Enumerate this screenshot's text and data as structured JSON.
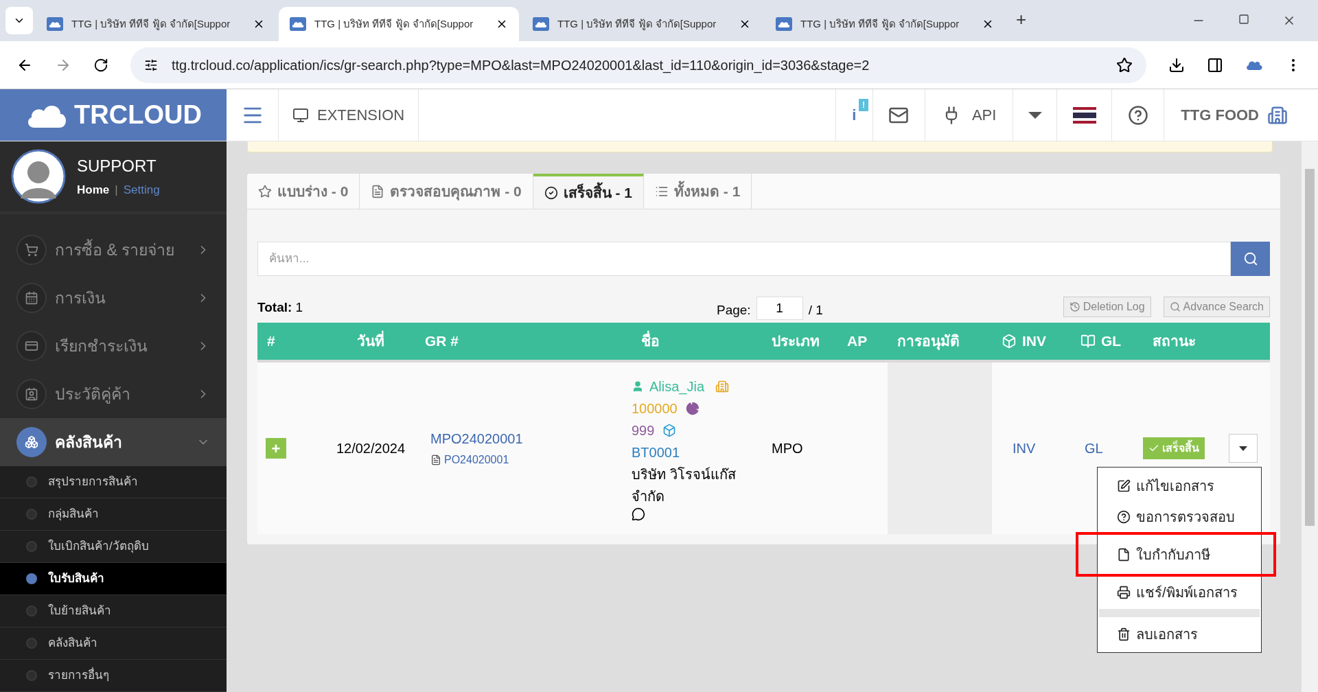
{
  "browser": {
    "tabs": [
      {
        "title": "TTG | บริษัท ทีทีจี ฟู้ด จำกัด[Suppor",
        "selected": false
      },
      {
        "title": "TTG | บริษัท ทีทีจี ฟู้ด จำกัด[Suppor",
        "selected": true
      },
      {
        "title": "TTG | บริษัท ทีทีจี ฟู้ด จำกัด[Suppor",
        "selected": false
      },
      {
        "title": "TTG | บริษัท ทีทีจี ฟู้ด จำกัด[Suppor",
        "selected": false
      }
    ],
    "new_tab": "+",
    "url": "ttg.trcloud.co/application/ics/gr-search.php?type=MPO&last=MPO24020001&last_id=110&origin_id=3036&stage=2"
  },
  "header": {
    "logo": "TRCLOUD",
    "extension": "EXTENSION",
    "info_icon": "i",
    "info_badge": "!",
    "api": "API",
    "company": "TTG FOOD"
  },
  "profile": {
    "name": "SUPPORT",
    "home": "Home",
    "separator": "|",
    "setting": "Setting"
  },
  "sidebar": {
    "items": [
      {
        "label": "การซื้อ & รายจ่าย",
        "kind": "cart",
        "selected": false
      },
      {
        "label": "การเงิน",
        "kind": "calendar",
        "selected": false
      },
      {
        "label": "เรียกชำระเงิน",
        "kind": "card",
        "selected": false
      },
      {
        "label": "ประวัติคู่ค้า",
        "kind": "contact",
        "selected": false
      },
      {
        "label": "คลังสินค้า",
        "kind": "boxes",
        "selected": true,
        "expanded": true,
        "children": [
          {
            "label": "สรุปรายการสินค้า",
            "selected": false
          },
          {
            "label": "กลุ่มสินค้า",
            "selected": false
          },
          {
            "label": "ใบเบิกสินค้า/วัตถุดิบ",
            "selected": false
          },
          {
            "label": "ใบรับสินค้า",
            "selected": true
          },
          {
            "label": "ใบย้ายสินค้า",
            "selected": false
          },
          {
            "label": "คลังสินค้า",
            "selected": false
          },
          {
            "label": "รายการอื่นๆ",
            "selected": false
          }
        ]
      }
    ]
  },
  "tabs": [
    {
      "label": "แบบร่าง - 0",
      "kind": "star",
      "selected": false
    },
    {
      "label": "ตรวจสอบคุณภาพ - 0",
      "kind": "doc",
      "selected": false
    },
    {
      "label": "เสร็จสิ้น - 1",
      "kind": "check",
      "selected": true
    },
    {
      "label": "ทั้งหมด - 1",
      "kind": "list",
      "selected": false
    }
  ],
  "search": {
    "placeholder": "ค้นหา..."
  },
  "summary": {
    "total_label": "Total:",
    "total": "1",
    "page_label": "Page:",
    "page": "1",
    "page_count": "/ 1"
  },
  "buttons": [
    "Deletion Log",
    "Advance Search"
  ],
  "table": {
    "columns": [
      {
        "label": "#",
        "kind": "plain"
      },
      {
        "label": "วันที่",
        "kind": "plain"
      },
      {
        "label": "GR #",
        "kind": "plain"
      },
      {
        "label": "ชื่อ",
        "kind": "plain"
      },
      {
        "label": "ประเภท",
        "kind": "plain"
      },
      {
        "label": "AP",
        "kind": "plain"
      },
      {
        "label": "การอนุมัติ",
        "kind": "plain"
      },
      {
        "label": "INV",
        "kind": "cube"
      },
      {
        "label": "GL",
        "kind": "book"
      },
      {
        "label": "สถานะ",
        "kind": "plain"
      }
    ],
    "rows": [
      {
        "expand": "+",
        "date": "12/02/2024",
        "gr": "MPO24020001",
        "po": "PO24020001",
        "contact": "Alisa_Jia",
        "amount": "100000",
        "qty": "999",
        "code": "BT0001",
        "company": "บริษัท วิโรจน์แก๊ส จำกัด",
        "type": "MPO",
        "inv": "INV",
        "gl": "GL",
        "status": "เสร็จสิ้น"
      }
    ]
  },
  "menu": {
    "items": [
      {
        "label": "แก้ไขเอกสาร",
        "kind": "edit",
        "highlighted": false
      },
      {
        "label": "ขอการตรวจสอบ",
        "kind": "question",
        "highlighted": false
      },
      {
        "label": "ใบกำกับภาษี",
        "kind": "file",
        "highlighted": true
      },
      {
        "label": "แชร์/พิมพ์เอกสาร",
        "kind": "print",
        "highlighted": false
      },
      {
        "label": "ลบเอกสาร",
        "kind": "trash",
        "highlighted": false
      }
    ]
  }
}
